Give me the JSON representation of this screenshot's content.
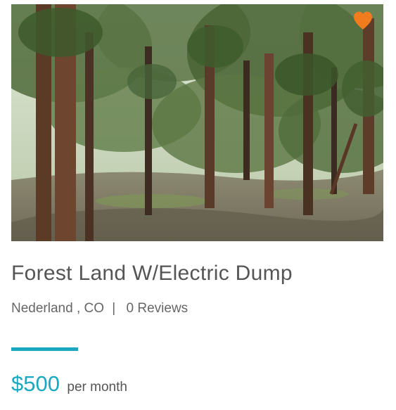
{
  "listing": {
    "image_alt": "Pine forest land photo",
    "favorite_icon": "heart-icon",
    "favorite_color": "#f07c1d",
    "title": "Forest Land W/Electric Dump",
    "location": "Nederland , CO",
    "separator": "|",
    "reviews": "0 Reviews",
    "price": "$500",
    "period": "per month"
  },
  "colors": {
    "accent": "#1aa8c1",
    "title_text": "#555555",
    "meta_text": "#666666"
  }
}
